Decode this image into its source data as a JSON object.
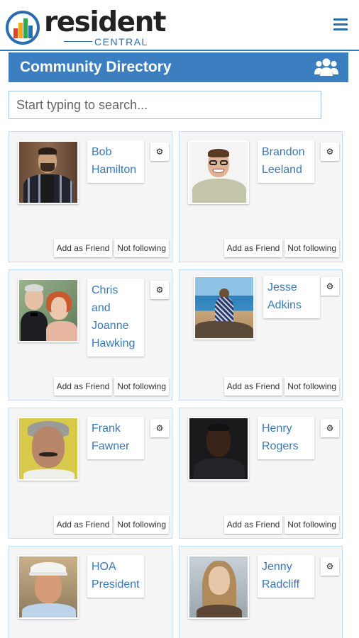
{
  "header": {
    "brand_name": "resident",
    "brand_sub": "CENTRAL",
    "menu_icon": "hamburger-icon",
    "accent": "#2a6eb0"
  },
  "title_bar": {
    "title": "Community Directory",
    "icon": "group-icon",
    "background": "#3b7fc0"
  },
  "search": {
    "placeholder": "Start typing to search..."
  },
  "residents": [
    {
      "name_line1": "Bob",
      "name_line2": "Hamilton",
      "name_line3": "",
      "add_label": "Add as Friend",
      "follow_label": "Not following",
      "has_gear": true
    },
    {
      "name_line1": "Brandon",
      "name_line2": "Leeland",
      "name_line3": "",
      "add_label": "Add as Friend",
      "follow_label": "Not following",
      "has_gear": true
    },
    {
      "name_line1": "Chris and",
      "name_line2": "Joanne",
      "name_line3": "Hawking",
      "add_label": "Add as Friend",
      "follow_label": "Not following",
      "has_gear": true
    },
    {
      "name_line1": "Jesse",
      "name_line2": "Adkins",
      "name_line3": "",
      "add_label": "Add as Friend",
      "follow_label": "Not following",
      "has_gear": true
    },
    {
      "name_line1": "Frank",
      "name_line2": "Fawner",
      "name_line3": "",
      "add_label": "Add as Friend",
      "follow_label": "Not following",
      "has_gear": true
    },
    {
      "name_line1": "Henry",
      "name_line2": "Rogers",
      "name_line3": "",
      "add_label": "Add as Friend",
      "follow_label": "Not following",
      "has_gear": true
    },
    {
      "name_line1": "HOA",
      "name_line2": "President",
      "name_line3": "",
      "add_label": "",
      "follow_label": "",
      "has_gear": false
    },
    {
      "name_line1": "Jenny",
      "name_line2": "Radcliff",
      "name_line3": "",
      "add_label": "",
      "follow_label": "",
      "has_gear": true
    }
  ],
  "icons": {
    "gear": "gear-icon"
  }
}
